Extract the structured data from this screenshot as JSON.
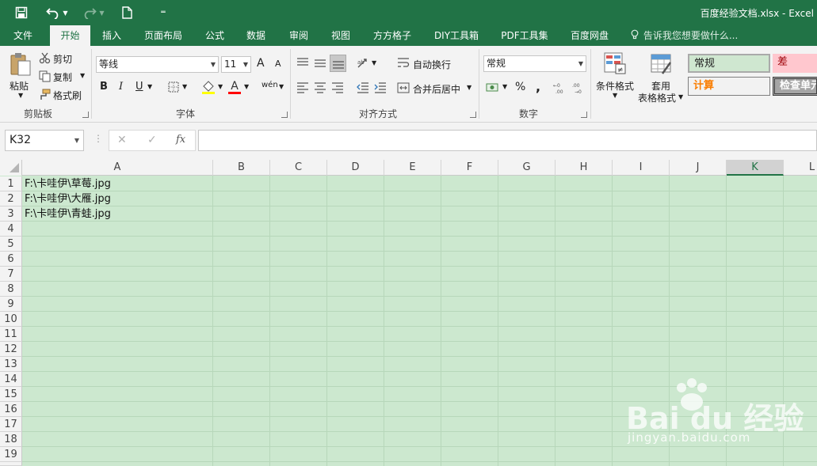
{
  "qat": {
    "save_icon": "save-icon",
    "undo_icon": "undo-icon",
    "redo_icon": "redo-icon",
    "new_icon": "new-file-icon",
    "customize_icon": "customize-qat-icon"
  },
  "window": {
    "title": "百度经验文档.xlsx - Excel"
  },
  "tabs": [
    {
      "label": "文件"
    },
    {
      "label": "开始"
    },
    {
      "label": "插入"
    },
    {
      "label": "页面布局"
    },
    {
      "label": "公式"
    },
    {
      "label": "数据"
    },
    {
      "label": "审阅"
    },
    {
      "label": "视图"
    },
    {
      "label": "方方格子"
    },
    {
      "label": "DIY工具箱"
    },
    {
      "label": "PDF工具集"
    },
    {
      "label": "百度网盘"
    }
  ],
  "tellme": {
    "text": "告诉我您想要做什么..."
  },
  "ribbon": {
    "clipboard": {
      "paste": "粘贴",
      "cut": "剪切",
      "copy": "复制",
      "format_painter": "格式刷",
      "label": "剪贴板"
    },
    "font": {
      "name": "等线",
      "size": "11",
      "label": "字体",
      "bold": "B",
      "italic": "I",
      "underline": "U",
      "grow": "A",
      "shrink": "A",
      "phonetic": "wén",
      "font_color_icon": "A"
    },
    "alignment": {
      "wrap": "自动换行",
      "merge": "合并后居中",
      "label": "对齐方式"
    },
    "number": {
      "format": "常规",
      "percent": "%",
      "comma": ",",
      "label": "数字"
    },
    "styles": {
      "conditional": "条件格式",
      "table_top": "套用",
      "table_bottom": "表格格式",
      "normal": "常规",
      "bad": "差",
      "calc": "计算",
      "check": "检查单元"
    }
  },
  "formula_bar": {
    "name_box": "K32",
    "cancel": "✕",
    "enter": "✓",
    "fx": "fx",
    "formula": ""
  },
  "grid": {
    "columns": [
      "A",
      "B",
      "C",
      "D",
      "E",
      "F",
      "G",
      "H",
      "I",
      "J",
      "K",
      "L"
    ],
    "selected_column": "K",
    "rows": [
      "1",
      "2",
      "3",
      "4",
      "5",
      "6",
      "7",
      "8",
      "9",
      "10",
      "11",
      "12",
      "13",
      "14",
      "15",
      "16",
      "17",
      "18",
      "19"
    ],
    "cells": [
      {
        "ref": "A1",
        "value": "F:\\卡哇伊\\草莓.jpg"
      },
      {
        "ref": "A2",
        "value": "F:\\卡哇伊\\大雁.jpg"
      },
      {
        "ref": "A3",
        "value": "F:\\卡哇伊\\青蛙.jpg"
      }
    ],
    "fill_color": "#cce8cf"
  },
  "watermark": {
    "logo": "Bai du 经验",
    "url": "jingyan.baidu.com"
  }
}
